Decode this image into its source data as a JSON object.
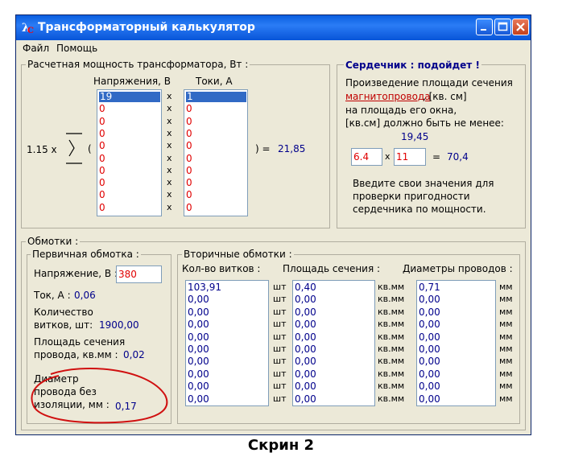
{
  "window": {
    "title": "Трансформаторный калькулятор"
  },
  "menu": [
    "Файл",
    "Помощь"
  ],
  "power": {
    "group_label": "Расчетная мощность трансформатора, Вт :",
    "voltage_header": "Напряжения, В",
    "current_header": "Токи, А",
    "coefficient": "1.15  x",
    "open_paren": "(",
    "result_label": ") =",
    "result_value": "21,85",
    "voltages": [
      "19",
      "0",
      "0",
      "0",
      "0",
      "0",
      "0",
      "0",
      "0",
      "0"
    ],
    "currents": [
      "1",
      "0",
      "0",
      "0",
      "0",
      "0",
      "0",
      "0",
      "0",
      "0"
    ],
    "times": "x"
  },
  "core": {
    "title": "Сердечник : подойдет !",
    "line1": "Произведение площади сечения",
    "link": "магнитопровода",
    "line2_rest": ", [кв. см]",
    "line3": "на площадь его окна,",
    "line4": "[кв.см] должно быть не менее:",
    "min_value": "19,45",
    "input_a": "6.4",
    "times": "x",
    "input_b": "11",
    "equals": "=",
    "product": "70,4",
    "hint1": "Введите свои значения для",
    "hint2": "проверки пригодности",
    "hint3": "сердечника по мощности."
  },
  "windings": {
    "group_label": "Обмотки :",
    "primary": {
      "group_label": "Первичная обмотка :",
      "voltage_label": "Напряжение, В :",
      "voltage_value": "380",
      "current_label": "Ток, А :",
      "current_value": "0,06",
      "turns_label_1": "Количество",
      "turns_label_2": "витков, шт:",
      "turns_value": "1900,00",
      "section_label_1": "Площадь сечения",
      "section_label_2": "провода, кв.мм :",
      "section_value": "0,02",
      "diam_label_1": "Диаметр",
      "diam_label_2": "провода без",
      "diam_label_3": "изоляции, мм :",
      "diam_value": "0,17"
    },
    "secondary": {
      "group_label": "Вторичные обмотки :",
      "turns_header": "Кол-во витков :",
      "section_header": "Площадь сечения :",
      "diam_header": "Диаметры проводов :",
      "unit_pcs": "шт",
      "unit_sqmm": "кв.мм",
      "unit_mm": "мм",
      "turns": [
        "103,91",
        "0,00",
        "0,00",
        "0,00",
        "0,00",
        "0,00",
        "0,00",
        "0,00",
        "0,00",
        "0,00"
      ],
      "sections": [
        "0,40",
        "0,00",
        "0,00",
        "0,00",
        "0,00",
        "0,00",
        "0,00",
        "0,00",
        "0,00",
        "0,00"
      ],
      "diameters": [
        "0,71",
        "0,00",
        "0,00",
        "0,00",
        "0,00",
        "0,00",
        "0,00",
        "0,00",
        "0,00",
        "0,00"
      ]
    }
  },
  "caption": "Скрин 2"
}
